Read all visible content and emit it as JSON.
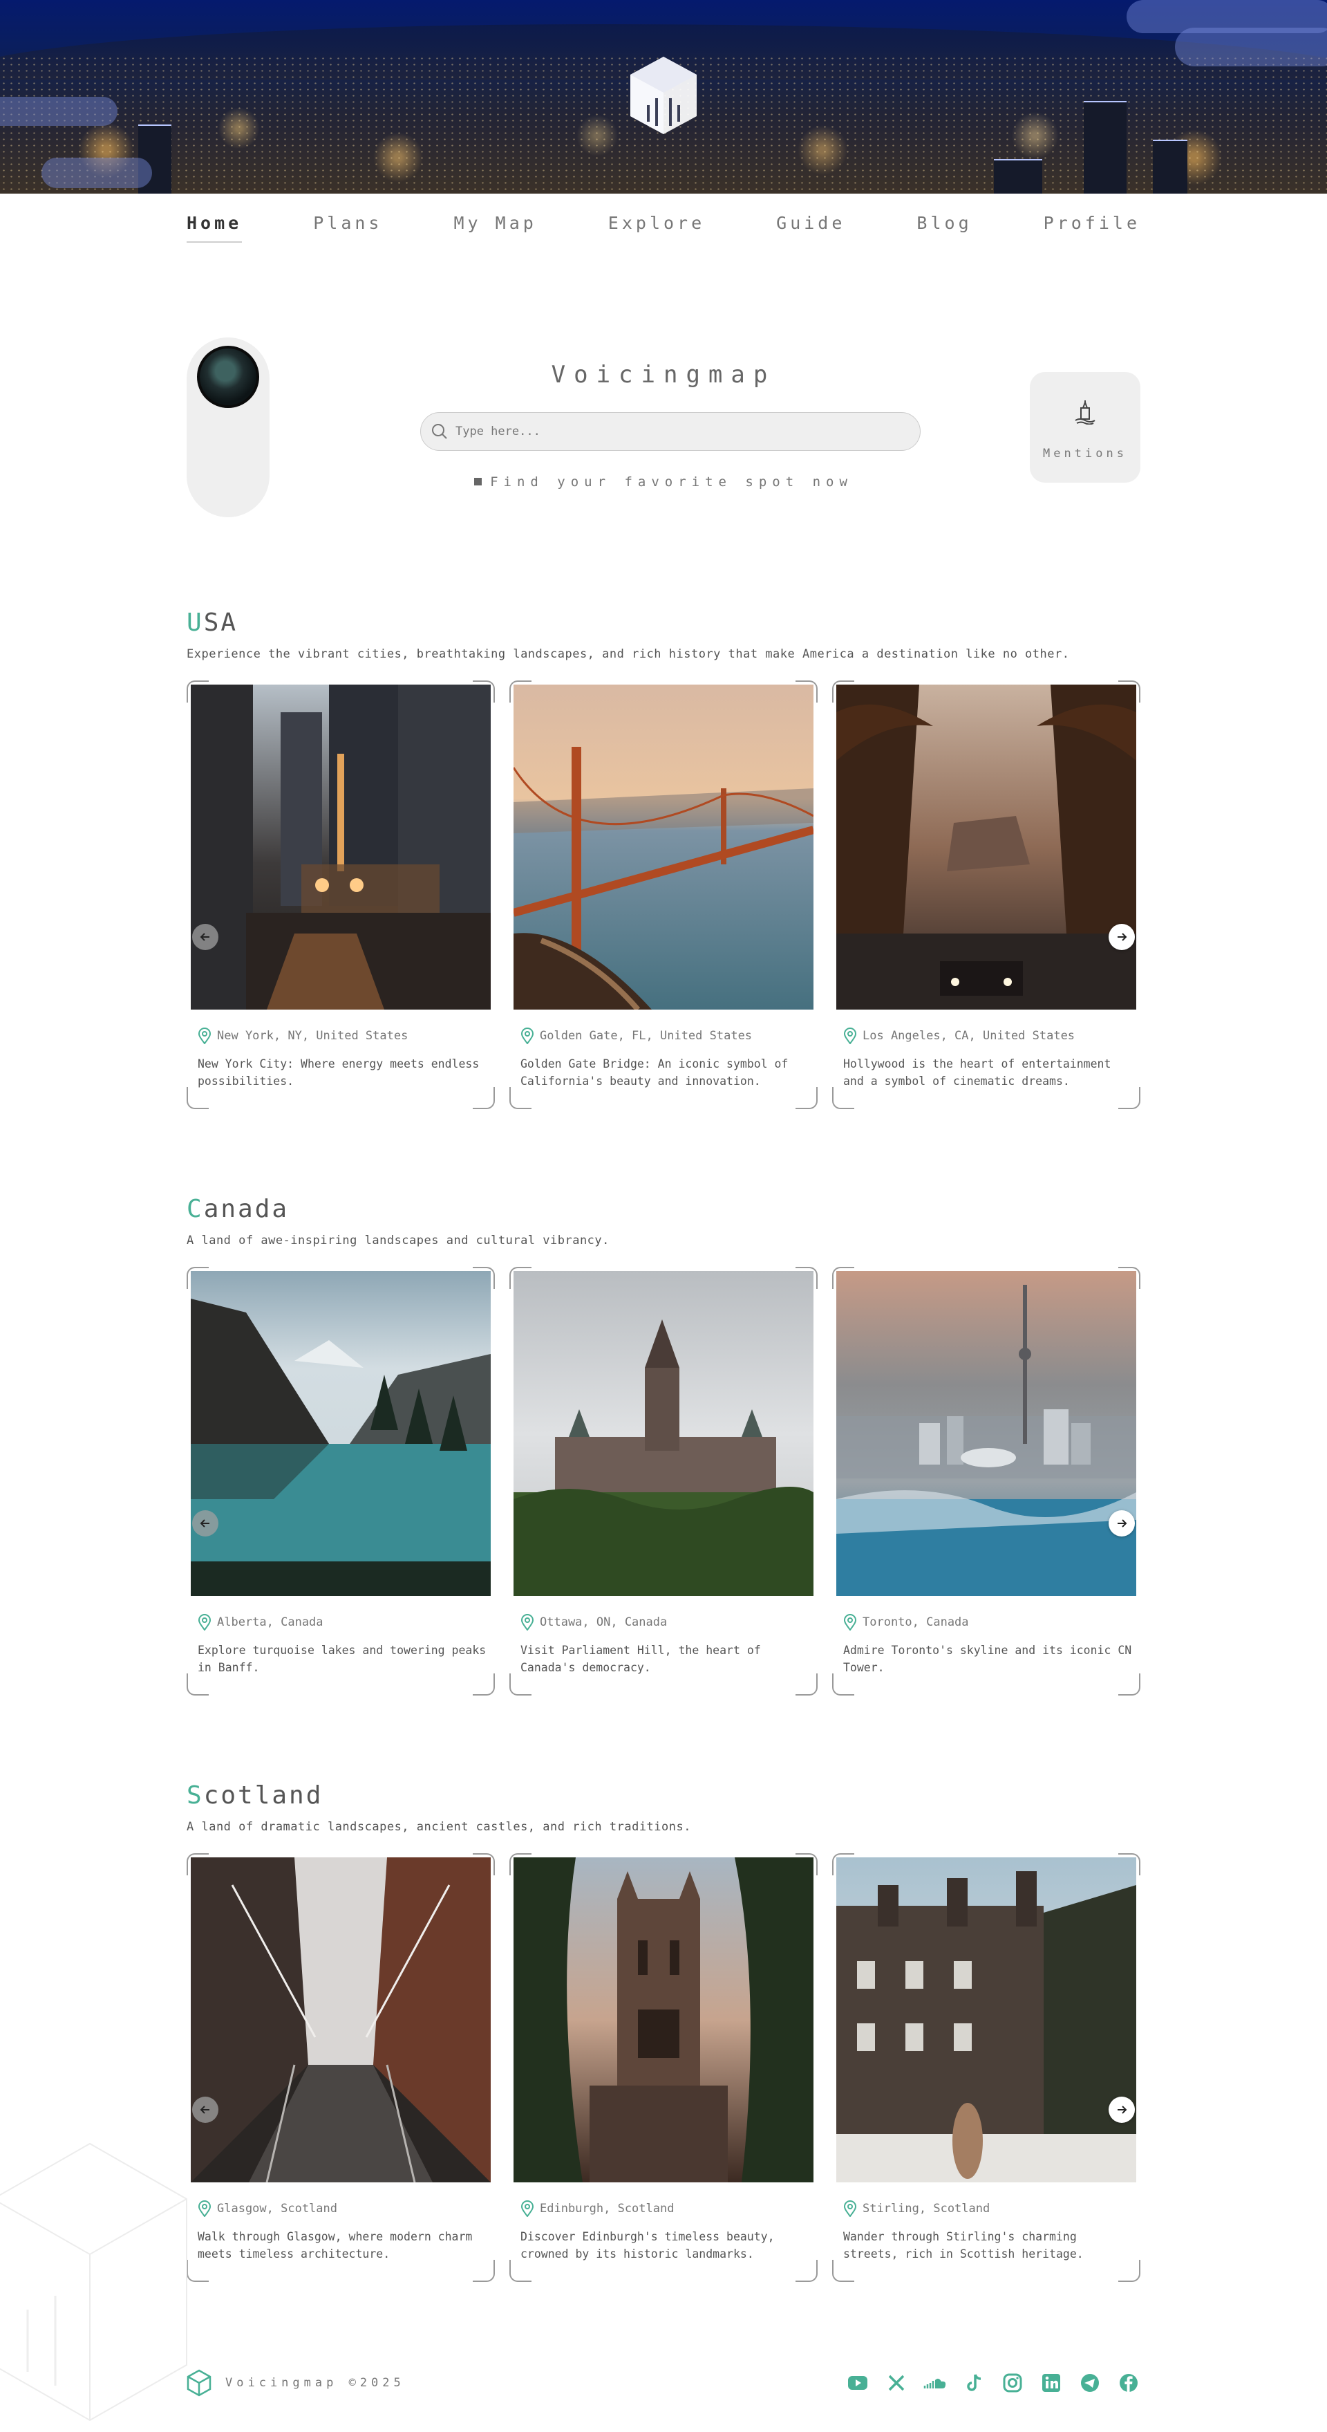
{
  "nav": {
    "items": [
      "Home",
      "Plans",
      "My Map",
      "Explore",
      "Guide",
      "Blog",
      "Profile"
    ]
  },
  "brand": {
    "title": "Voicingmap",
    "tagline": "Find your favorite spot now"
  },
  "search": {
    "placeholder": "Type here..."
  },
  "mentions": {
    "label": "Mentions"
  },
  "colors": {
    "accent": "#48b095",
    "hero": "#051a6e"
  },
  "sections": [
    {
      "title_first": "U",
      "title_rest": "SA",
      "description": "Experience the vibrant cities, breathtaking landscapes, and rich history that make America a destination like no other.",
      "cards": [
        {
          "location": "New York, NY, United States",
          "description": "New York City: Where energy meets endless possibilities."
        },
        {
          "location": "Golden Gate, FL, United States",
          "description": "Golden Gate Bridge: An iconic symbol of California's beauty and innovation."
        },
        {
          "location": "Los Angeles, CA, United States",
          "description": "Hollywood is the heart of entertainment and a symbol of cinematic dreams."
        }
      ]
    },
    {
      "title_first": "C",
      "title_rest": "anada",
      "description": "A land of awe-inspiring landscapes and cultural vibrancy.",
      "cards": [
        {
          "location": "Alberta, Canada",
          "description": "Explore turquoise lakes and towering peaks in Banff."
        },
        {
          "location": "Ottawa, ON, Canada",
          "description": "Visit Parliament Hill, the heart of Canada's democracy."
        },
        {
          "location": "Toronto, Canada",
          "description": "Admire Toronto's skyline and its iconic CN Tower."
        }
      ]
    },
    {
      "title_first": "S",
      "title_rest": "cotland",
      "description": "A land of dramatic landscapes, ancient castles, and rich traditions.",
      "cards": [
        {
          "location": "Glasgow, Scotland",
          "description": "Walk through Glasgow, where modern charm meets timeless architecture."
        },
        {
          "location": "Edinburgh, Scotland",
          "description": "Discover Edinburgh's timeless beauty, crowned by its historic landmarks."
        },
        {
          "location": "Stirling, Scotland",
          "description": "Wander through Stirling's charming streets, rich in Scottish heritage."
        }
      ]
    }
  ],
  "footer": {
    "brand": "Voicingmap ©2025",
    "socials": [
      "youtube-icon",
      "x-icon",
      "soundcloud-icon",
      "tiktok-icon",
      "instagram-icon",
      "linkedin-icon",
      "telegram-icon",
      "facebook-icon"
    ]
  }
}
